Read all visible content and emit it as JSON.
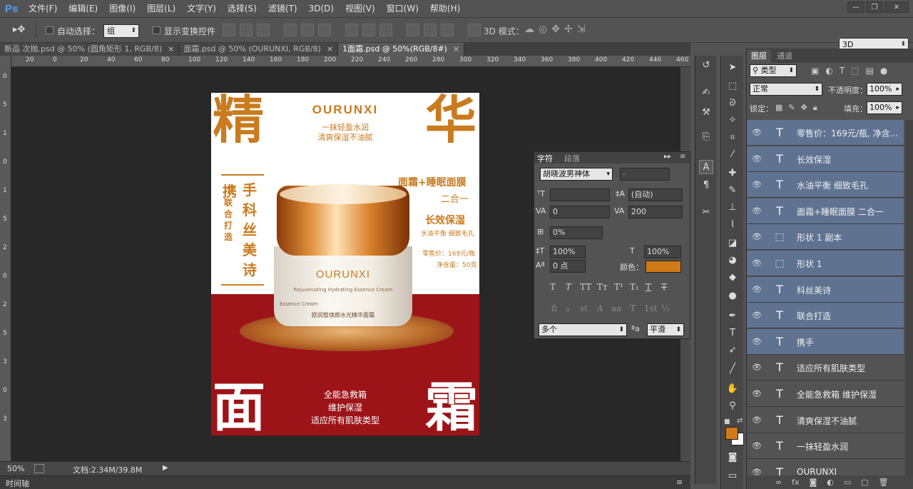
{
  "app": {
    "logo": "Ps"
  },
  "menu": [
    "文件(F)",
    "编辑(E)",
    "图像(I)",
    "图层(L)",
    "文字(Y)",
    "选择(S)",
    "滤镜(T)",
    "3D(D)",
    "视图(V)",
    "窗口(W)",
    "帮助(H)"
  ],
  "window_controls": {
    "minimize": "—",
    "restore": "❐",
    "close": "✕"
  },
  "options": {
    "tool_glyph": "▸✥",
    "auto_select_label": "自动选择：",
    "auto_select_value": "组",
    "show_transform_label": "显示变换控件",
    "mode_3d_label": "3D 模式：",
    "workspace_value": "3D"
  },
  "tabs": [
    {
      "label": "新品 次抛.psd @ 50% (圆角矩形 1, RGB/8)",
      "close": "×"
    },
    {
      "label": "面霜.psd @ 50% (OURUNXI, RGB/8)",
      "close": "×"
    },
    {
      "label": "1面霜.psd @ 50%(RGB/8#)",
      "close": "×"
    }
  ],
  "ruler": {
    "h": [
      "20",
      "0",
      "20",
      "40",
      "60",
      "80",
      "100",
      "120",
      "140",
      "160",
      "180",
      "200",
      "220",
      "240",
      "260",
      "280",
      "300",
      "320",
      "340",
      "360",
      "380",
      "400",
      "420",
      "440",
      "460"
    ],
    "v": [
      "0",
      "5",
      "1",
      "0",
      "1",
      "5",
      "2",
      "0",
      "2",
      "5",
      "3",
      "0",
      "3"
    ]
  },
  "status": {
    "zoom": "50%",
    "doc_info": "文档:2.34M/39.8M",
    "play": "▶"
  },
  "timeline": {
    "label": "时间轴"
  },
  "poster": {
    "corner_tl": "精",
    "corner_tr": "华",
    "corner_bl": "面",
    "corner_br": "霜",
    "brand": "OURUNXI",
    "sub1": "一抹轻盈水润",
    "sub2": "清爽保湿不油腻",
    "collab_big1": "携",
    "collab_small": "联合打造",
    "collab_big2": "手科丝美诗",
    "combo": "面霜+睡眠面膜",
    "two_in_one": "二合一",
    "long_moist": "长效保湿",
    "balance": "水油平衡  细致毛孔",
    "price": "零售价：169元/瓶",
    "net": "净含量：50克",
    "jar_brand": "OURUNXI",
    "jar_line1": "Rejuvenating Hydrating Essence Cream",
    "jar_line2": "Essence Cream",
    "jar_cn": "欧润皙焕颜水光精华面霜",
    "bottom1": "全能急救箱",
    "bottom2": "维护保湿",
    "bottom3": "适应所有肌肤类型"
  },
  "char_panel": {
    "tab1": "字符",
    "tab2": "段落",
    "font_family": "胡晓波男神体",
    "font_style": "-",
    "font_size": "",
    "leading": "(自动)",
    "kerning": "0",
    "tracking": "200",
    "scale_pct": "0%",
    "vscale": "100%",
    "hscale": "100%",
    "baseline": "0 点",
    "color_label": "颜色：",
    "color_hex": "#d07a18",
    "styles": [
      "T",
      "T",
      "TT",
      "Tт",
      "T¹",
      "T₁",
      "T",
      "T"
    ],
    "ligatures": [
      "ﬁ",
      "ℴ",
      "st",
      "A",
      "aa",
      "T",
      "1st",
      "½"
    ],
    "language": "多个",
    "aa_label": "ªa",
    "antialias": "平滑"
  },
  "layers_panel": {
    "tab1": "图层",
    "tab2": "通道",
    "kind": "类型",
    "blend": "正常",
    "opacity_label": "不透明度：",
    "opacity": "100%",
    "lock_label": "锁定：",
    "fill_label": "填充：",
    "fill": "100%",
    "layers": [
      {
        "name": "零售价：169元/瓶, 净含...",
        "type": "T",
        "selected": true
      },
      {
        "name": "长效保湿",
        "type": "T",
        "selected": true
      },
      {
        "name": "水油平衡  细致毛孔",
        "type": "T",
        "selected": true
      },
      {
        "name": "面霜+睡眠面膜  二合一",
        "type": "T",
        "selected": true
      },
      {
        "name": "形状 1 副本",
        "type": "shape",
        "selected": true
      },
      {
        "name": "形状 1",
        "type": "shape",
        "selected": true
      },
      {
        "name": "科丝美诗",
        "type": "T",
        "selected": true
      },
      {
        "name": "联合打造",
        "type": "T",
        "selected": true
      },
      {
        "name": "携手",
        "type": "T",
        "selected": true
      },
      {
        "name": "适应所有肌肤类型",
        "type": "T",
        "selected": false
      },
      {
        "name": "全能急救箱  维护保湿",
        "type": "T",
        "selected": false
      },
      {
        "name": "清爽保湿不油腻",
        "type": "T",
        "selected": false
      },
      {
        "name": "一抹轻盈水润",
        "type": "T",
        "selected": false
      },
      {
        "name": "OURUNXI",
        "type": "T",
        "selected": false
      }
    ]
  },
  "colors": {
    "accent_orange": "#c97b1e",
    "poster_red": "#9c1418",
    "layer_selected": "#5f7391"
  }
}
